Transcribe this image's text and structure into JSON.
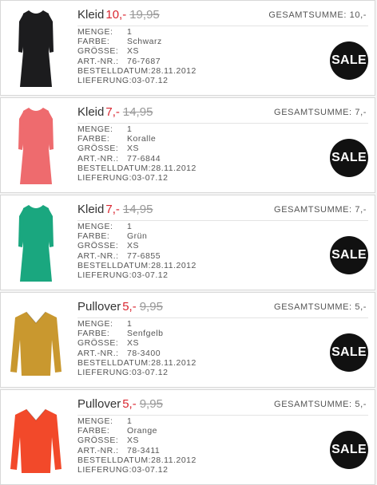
{
  "items": [
    {
      "name": "Kleid",
      "price_new": "10,-",
      "price_old": "19,95",
      "total_label": "GESAMTSUMME: 10,-",
      "details": [
        {
          "k": "MENGE:",
          "v": "1"
        },
        {
          "k": "FARBE:",
          "v": "Schwarz"
        },
        {
          "k": "GRÖSSE:",
          "v": "XS"
        },
        {
          "k": "ART.-NR.:",
          "v": "76-7687"
        },
        {
          "k": "BESTELLDATUM:",
          "v": "28.11.2012"
        },
        {
          "k": "LIEFERUNG:",
          "v": "03-07.12"
        }
      ],
      "badge": "SALE",
      "garment": "dress-icon",
      "color": "#1c1c1e"
    },
    {
      "name": "Kleid",
      "price_new": "7,-",
      "price_old": "14,95",
      "total_label": "GESAMTSUMME: 7,-",
      "details": [
        {
          "k": "MENGE:",
          "v": "1"
        },
        {
          "k": "FARBE:",
          "v": "Koralle"
        },
        {
          "k": "GRÖSSE:",
          "v": "XS"
        },
        {
          "k": "ART.-NR.:",
          "v": "77-6844"
        },
        {
          "k": "BESTELLDATUM:",
          "v": "28.11.2012"
        },
        {
          "k": "LIEFERUNG:",
          "v": "03-07.12"
        }
      ],
      "badge": "SALE",
      "garment": "dress-icon",
      "color": "#ee6b6e"
    },
    {
      "name": "Kleid",
      "price_new": "7,-",
      "price_old": "14,95",
      "total_label": "GESAMTSUMME: 7,-",
      "details": [
        {
          "k": "MENGE:",
          "v": "1"
        },
        {
          "k": "FARBE:",
          "v": "Grün"
        },
        {
          "k": "GRÖSSE:",
          "v": "XS"
        },
        {
          "k": "ART.-NR.:",
          "v": "77-6855"
        },
        {
          "k": "BESTELLDATUM:",
          "v": "28.11.2012"
        },
        {
          "k": "LIEFERUNG:",
          "v": "03-07.12"
        }
      ],
      "badge": "SALE",
      "garment": "dress-icon",
      "color": "#1aa77f"
    },
    {
      "name": "Pullover",
      "price_new": "5,-",
      "price_old": "9,95",
      "total_label": "GESAMTSUMME: 5,-",
      "details": [
        {
          "k": "MENGE:",
          "v": "1"
        },
        {
          "k": "FARBE:",
          "v": "Senfgelb"
        },
        {
          "k": "GRÖSSE:",
          "v": "XS"
        },
        {
          "k": "ART.-NR.:",
          "v": "78-3400"
        },
        {
          "k": "BESTELLDATUM:",
          "v": "28.11.2012"
        },
        {
          "k": "LIEFERUNG:",
          "v": "03-07.12"
        }
      ],
      "badge": "SALE",
      "garment": "sweater-icon",
      "color": "#c9982f"
    },
    {
      "name": "Pullover",
      "price_new": "5,-",
      "price_old": "9,95",
      "total_label": "GESAMTSUMME: 5,-",
      "details": [
        {
          "k": "MENGE:",
          "v": "1"
        },
        {
          "k": "FARBE:",
          "v": "Orange"
        },
        {
          "k": "GRÖSSE:",
          "v": "XS"
        },
        {
          "k": "ART.-NR.:",
          "v": "78-3411"
        },
        {
          "k": "BESTELLDATUM:",
          "v": "28.11.2012"
        },
        {
          "k": "LIEFERUNG:",
          "v": "03-07.12"
        }
      ],
      "badge": "SALE",
      "garment": "sweater-icon",
      "color": "#f2492a"
    }
  ]
}
